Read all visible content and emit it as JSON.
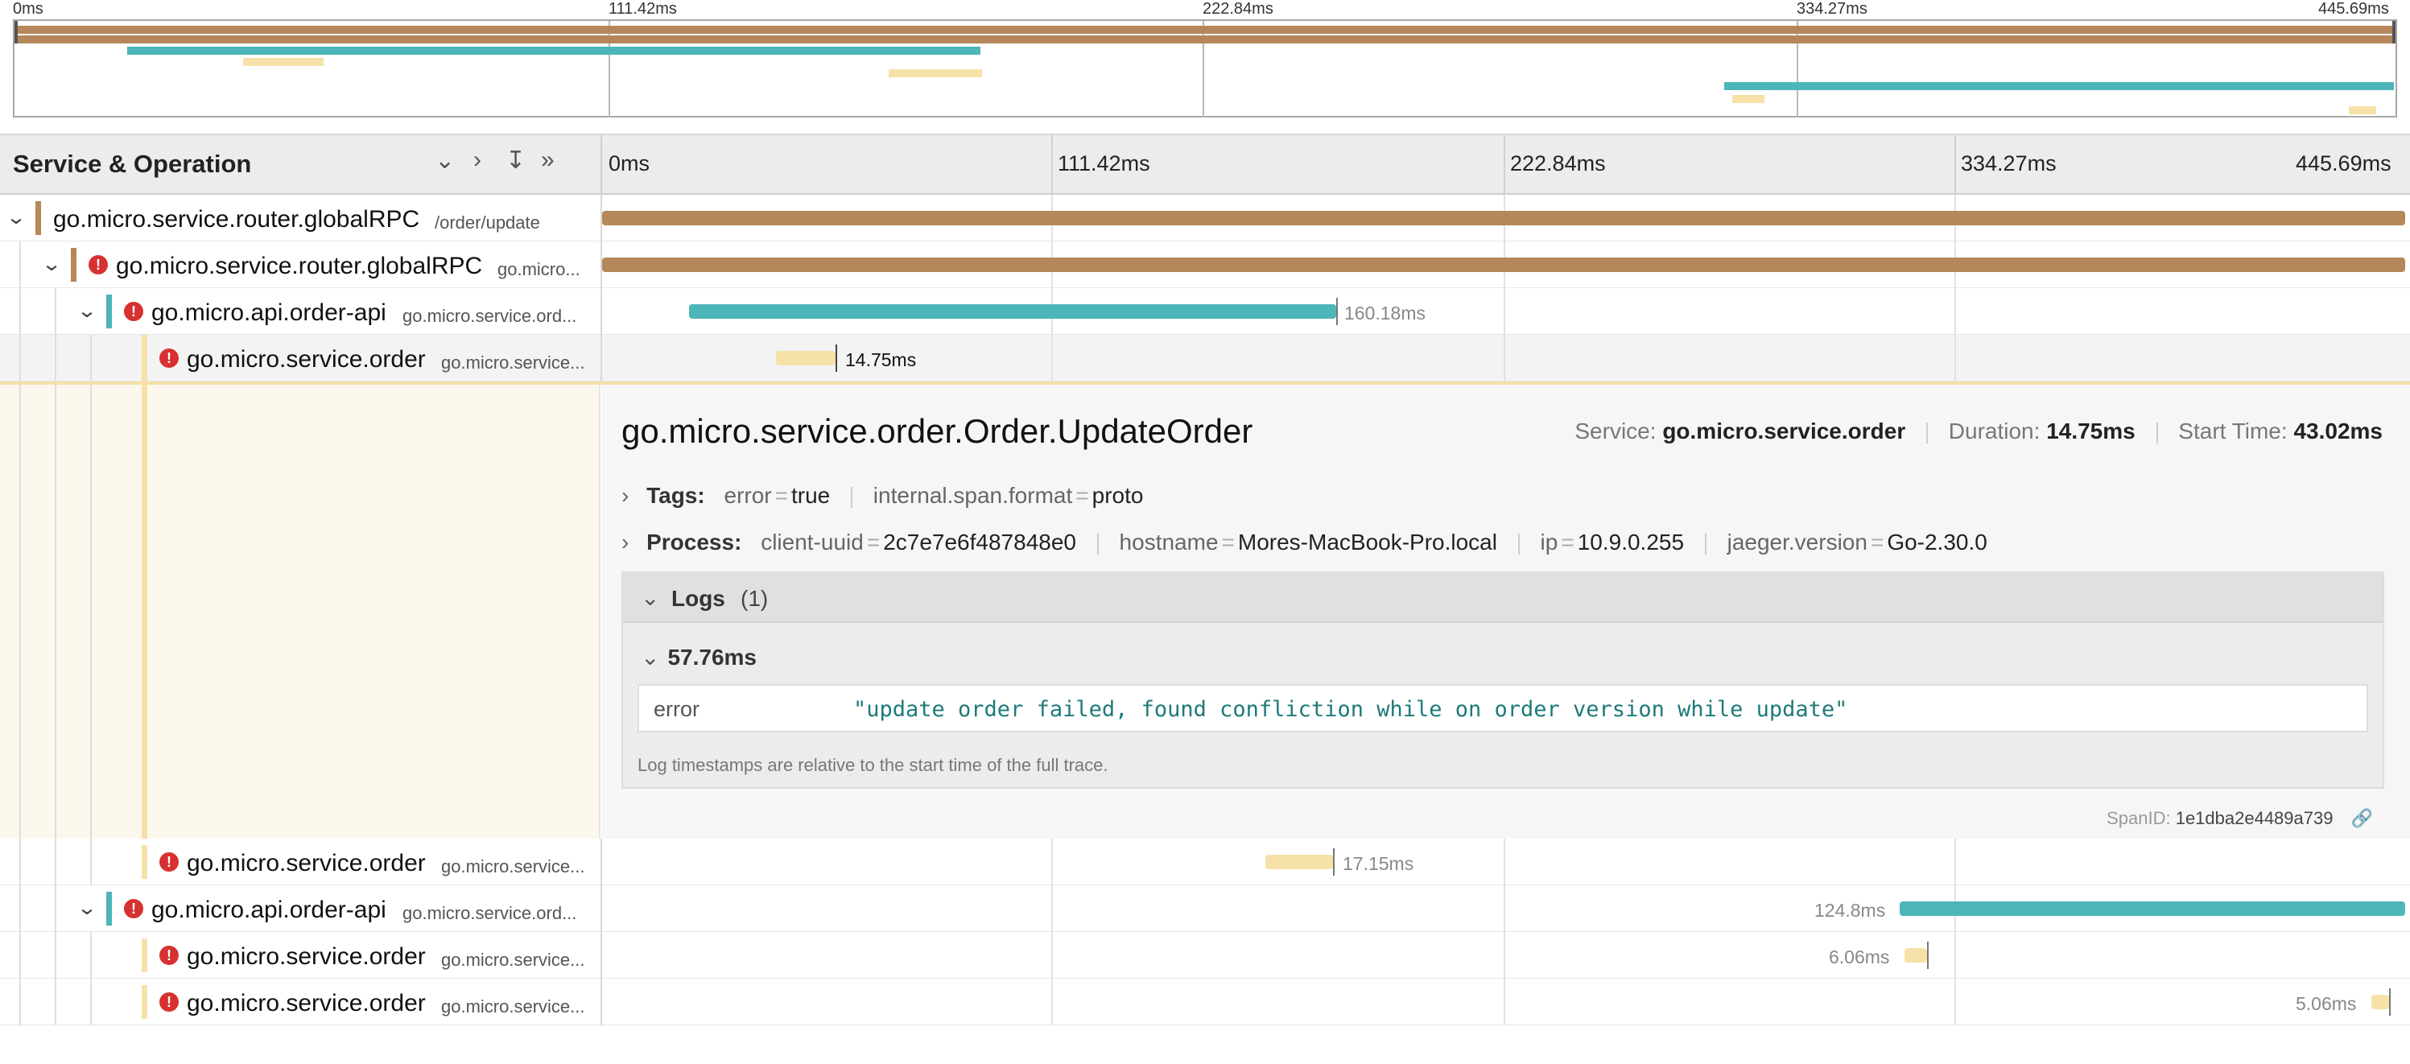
{
  "minimap": {
    "ticks": [
      "0ms",
      "111.42ms",
      "222.84ms",
      "334.27ms",
      "445.69ms"
    ]
  },
  "header": {
    "title": "Service & Operation",
    "controls": [
      "chevron-down",
      "chevron-right",
      "double-chevron-down",
      "double-chevron-right"
    ],
    "ticks": [
      "0ms",
      "111.42ms",
      "222.84ms",
      "334.27ms",
      "445.69ms"
    ]
  },
  "colors": {
    "router": "#b5875a",
    "api": "#4db6b9",
    "order": "#f6e1a9",
    "error": "#d73131"
  },
  "spans": [
    {
      "service": "go.micro.service.router.globalRPC",
      "operation": "/order/update",
      "label": ""
    },
    {
      "service": "go.micro.service.router.globalRPC",
      "operation": "go.micro...",
      "label": ""
    },
    {
      "service": "go.micro.api.order-api",
      "operation": "go.micro.service.ord...",
      "label": "160.18ms"
    },
    {
      "service": "go.micro.service.order",
      "operation": "go.micro.service...",
      "label": "14.75ms"
    },
    {
      "service": "go.micro.service.order",
      "operation": "go.micro.service...",
      "label": "17.15ms"
    },
    {
      "service": "go.micro.api.order-api",
      "operation": "go.micro.service.ord...",
      "label": "124.8ms"
    },
    {
      "service": "go.micro.service.order",
      "operation": "go.micro.service...",
      "label": "6.06ms"
    },
    {
      "service": "go.micro.service.order",
      "operation": "go.micro.service...",
      "label": "5.06ms"
    }
  ],
  "detail": {
    "title": "go.micro.service.order.Order.UpdateOrder",
    "service_label": "Service:",
    "service": "go.micro.service.order",
    "duration_label": "Duration:",
    "duration": "14.75ms",
    "start_label": "Start Time:",
    "start": "43.02ms",
    "tags_label": "Tags:",
    "tags": [
      {
        "k": "error",
        "v": "true"
      },
      {
        "k": "internal.span.format",
        "v": "proto"
      }
    ],
    "process_label": "Process:",
    "process": [
      {
        "k": "client-uuid",
        "v": "2c7e7e6f487848e0"
      },
      {
        "k": "hostname",
        "v": "Mores-MacBook-Pro.local"
      },
      {
        "k": "ip",
        "v": "10.9.0.255"
      },
      {
        "k": "jaeger.version",
        "v": "Go-2.30.0"
      }
    ],
    "logs_label": "Logs",
    "logs_count": "(1)",
    "log_time": "57.76ms",
    "log_key": "error",
    "log_value": "\"update order failed, found confliction while on order version while update\"",
    "log_note": "Log timestamps are relative to the start time of the full trace.",
    "spanid_label": "SpanID:",
    "spanid": "1e1dba2e4489a739"
  }
}
